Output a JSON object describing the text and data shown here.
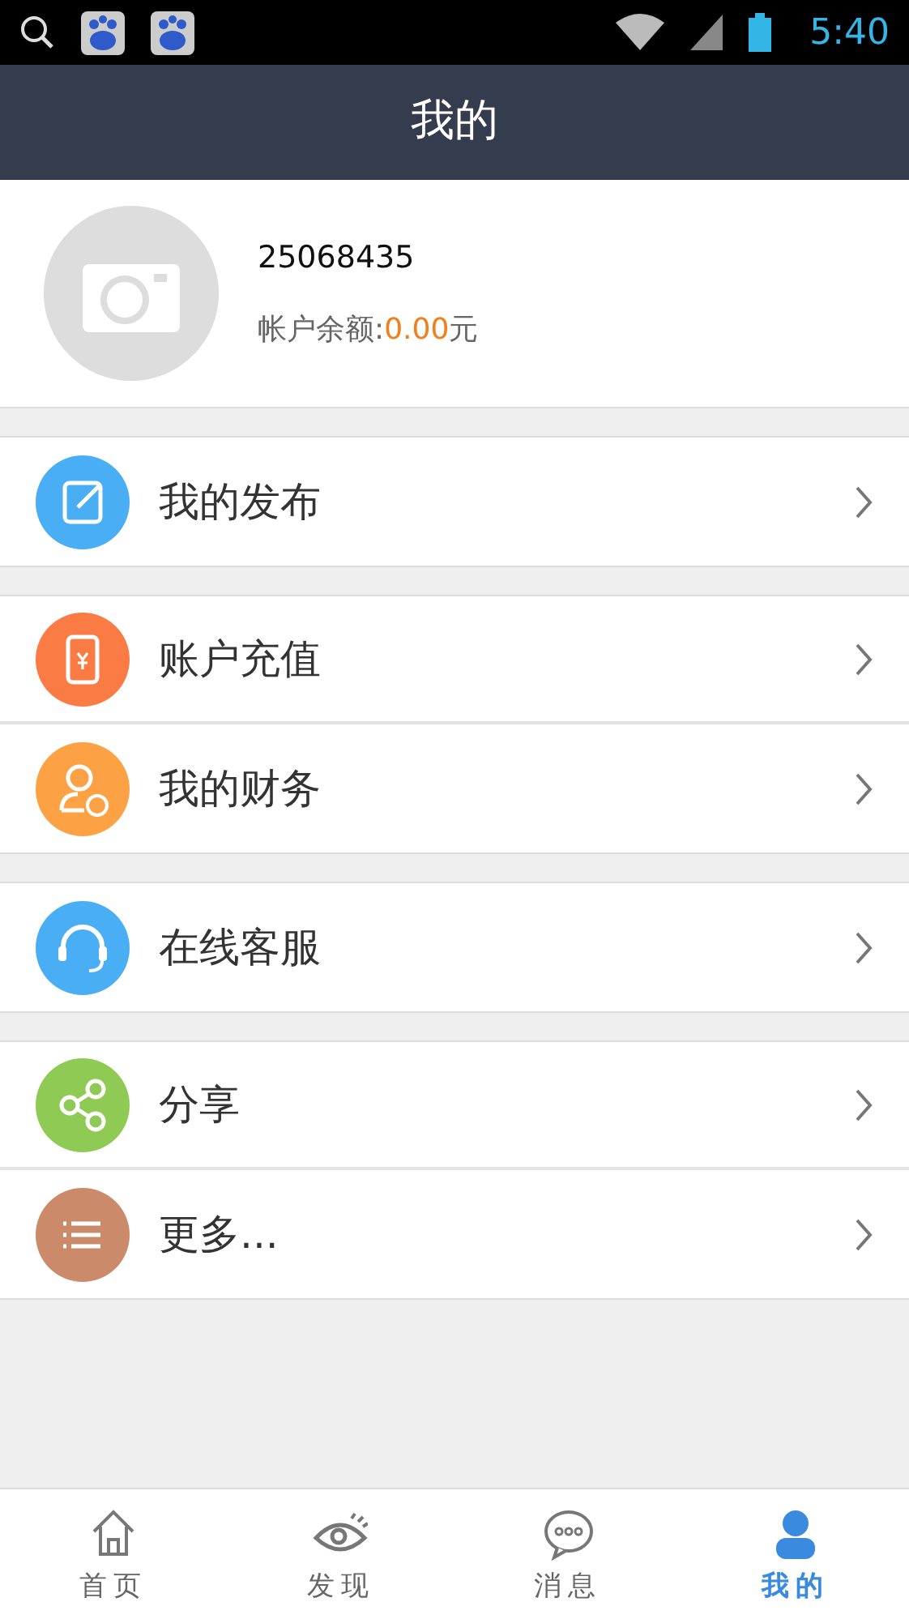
{
  "status_bar": {
    "time": "5:40"
  },
  "header": {
    "title": "我的"
  },
  "profile": {
    "user_id": "25068435",
    "balance_label": "帐户余额:",
    "balance": "0.00",
    "currency": "元"
  },
  "menu_groups": [
    {
      "items": [
        {
          "label": "我的发布",
          "kind": "edit",
          "color": "#4aaef5"
        }
      ]
    },
    {
      "items": [
        {
          "label": "账户充值",
          "kind": "phone",
          "color": "#fb7b45"
        },
        {
          "label": "我的财务",
          "kind": "finance",
          "color": "#fca144"
        }
      ]
    },
    {
      "items": [
        {
          "label": "在线客服",
          "kind": "headset",
          "color": "#4aaef5"
        }
      ]
    },
    {
      "items": [
        {
          "label": "分享",
          "kind": "share",
          "color": "#8fcb54"
        },
        {
          "label": "更多...",
          "kind": "list",
          "color": "#cb8b6a"
        }
      ]
    }
  ],
  "tab_bar": [
    {
      "label": "首页",
      "kind": "home",
      "selected": false
    },
    {
      "label": "发现",
      "kind": "eye",
      "selected": false
    },
    {
      "label": "消息",
      "kind": "chat",
      "selected": false
    },
    {
      "label": "我的",
      "kind": "person",
      "selected": true
    }
  ]
}
